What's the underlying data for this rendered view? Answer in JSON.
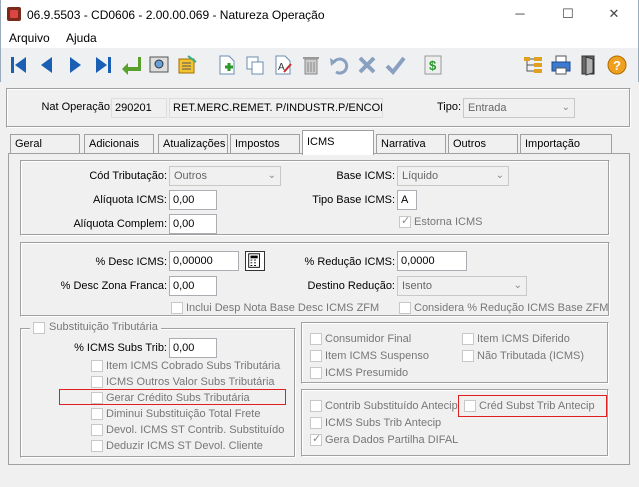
{
  "window": {
    "title": "06.9.5503 - CD0606 - 2.00.00.069 - Natureza Operação",
    "minimize": "─",
    "maximize": "☐",
    "close": "✕"
  },
  "menu": {
    "arquivo": "Arquivo",
    "ajuda": "Ajuda"
  },
  "header": {
    "nat_label": "Nat Operação:",
    "nat_code": "290201",
    "nat_desc": "RET.MERC.REMET. P/INDUSTR.P/ENCOMEN",
    "tipo_label": "Tipo:",
    "tipo_value": "Entrada"
  },
  "tabs": [
    "Geral",
    "Adicionais",
    "Atualizações",
    "Impostos",
    "ICMS",
    "Narrativa",
    "Outros",
    "Importação"
  ],
  "section1": {
    "cod_trib_label": "Cód Tributação:",
    "cod_trib_value": "Outros",
    "aliq_label": "Alíquota ICMS:",
    "aliq_value": "0,00",
    "aliq_comp_label": "Alíquota Complem:",
    "aliq_comp_value": "0,00",
    "base_label": "Base ICMS:",
    "base_value": "Líquido",
    "tipo_base_label": "Tipo Base ICMS:",
    "tipo_base_value": "A",
    "estorna_label": "Estorna ICMS"
  },
  "section2": {
    "desc_label": "% Desc ICMS:",
    "desc_value": "0,00000",
    "desc_zona_label": "% Desc Zona Franca:",
    "desc_zona_value": "0,00",
    "reducao_label": "% Redução ICMS:",
    "reducao_value": "0,0000",
    "destino_label": "Destino Redução:",
    "destino_value": "Isento",
    "inclui_label": "Inclui Desp Nota Base Desc ICMS ZFM",
    "considera_label": "Considera % Redução ICMS Base ZFM"
  },
  "subst": {
    "title": "Substituição Tributária",
    "icms_subs_label": "% ICMS Subs Trib:",
    "icms_subs_value": "0,00",
    "items": [
      "Item ICMS Cobrado Subs Tributária",
      "ICMS Outros Valor Subs Tributária",
      "Gerar Crédito Subs Tributária",
      "Diminui Substituição Total Frete",
      "Devol. ICMS ST Contrib. Substituído",
      "Deduzir ICMS ST Devol. Cliente"
    ]
  },
  "right1": {
    "consumidor": "Consumidor Final",
    "item_suspenso": "Item ICMS Suspenso",
    "presumido": "ICMS Presumido",
    "item_diferido": "Item ICMS Diferido",
    "nao_tributada": "Não Tributada (ICMS)"
  },
  "right2": {
    "contrib": "Contrib Substituído Antecip",
    "cred": "Créd Subst Trib Antecip",
    "icms_subs_antecip": "ICMS Subs Trib Antecip",
    "gera_dados": "Gera Dados Partilha DIFAL"
  }
}
